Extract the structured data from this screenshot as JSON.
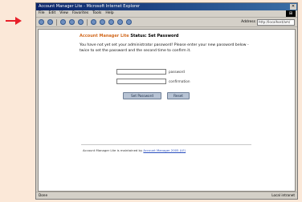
{
  "colors": {
    "accent": "#d2691e",
    "marker": "#e8202a",
    "link": "#2a4fbf"
  },
  "browser": {
    "title": "Account Manager Lite - Microsoft Internet Explorer",
    "menu": [
      "File",
      "Edit",
      "View",
      "Favorites",
      "Tools",
      "Help"
    ],
    "address_label": "Address",
    "address_value": "http://localhost/am/"
  },
  "page": {
    "app_name": "Account Manager Lite",
    "heading": "Status: Set Password",
    "instructions": "You have not yet set your administrator password! Please enter your new password below - twice to set the password and the second time to confirm it.",
    "password_label": "password",
    "confirm_label": "confirmation",
    "set_button": "Set Password",
    "reset_button": "Reset",
    "footer_text": "Account Manager Lite is maintained by",
    "footer_link": "Account Manager 2005 (LE)"
  },
  "status": {
    "left": "Done",
    "right": "Local intranet"
  }
}
